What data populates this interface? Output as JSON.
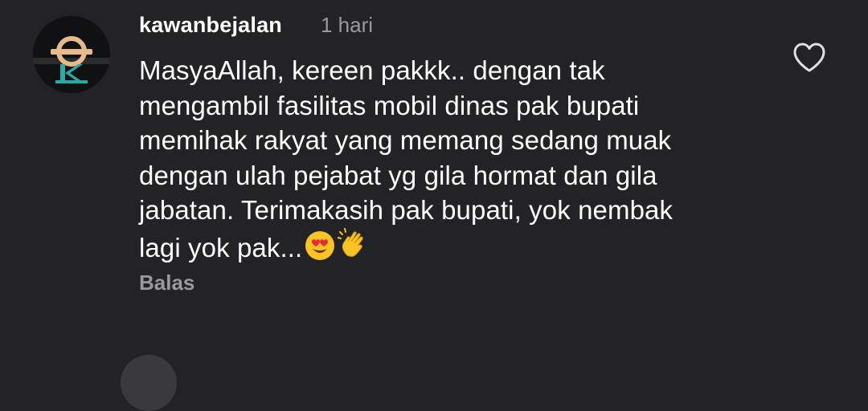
{
  "comment": {
    "username": "kawanbejalan",
    "timestamp": "1 hari",
    "lines": [
      "MasyaAllah, kereen pakkk.. dengan tak",
      "mengambil fasilitas mobil dinas pak bupati",
      "memihak rakyat yang memang sedang muak",
      "dengan ulah pejabat yg gila hormat dan gila",
      "jabatan. Terimakasih pak bupati, yok nembak",
      "lagi yok pak..."
    ],
    "emojis": [
      "heart-eyes-emoji",
      "clapping-hands-emoji"
    ],
    "reply_label": "Balas",
    "like_icon": "heart-outline-icon"
  },
  "next_comment": {
    "username": "",
    "timestamp": ""
  },
  "colors": {
    "background": "#232325",
    "text_primary": "#ffffff",
    "text_secondary": "#9a9a9c",
    "avatar_accent_orange": "#e8b98a",
    "avatar_accent_teal": "#2aa9a3"
  }
}
